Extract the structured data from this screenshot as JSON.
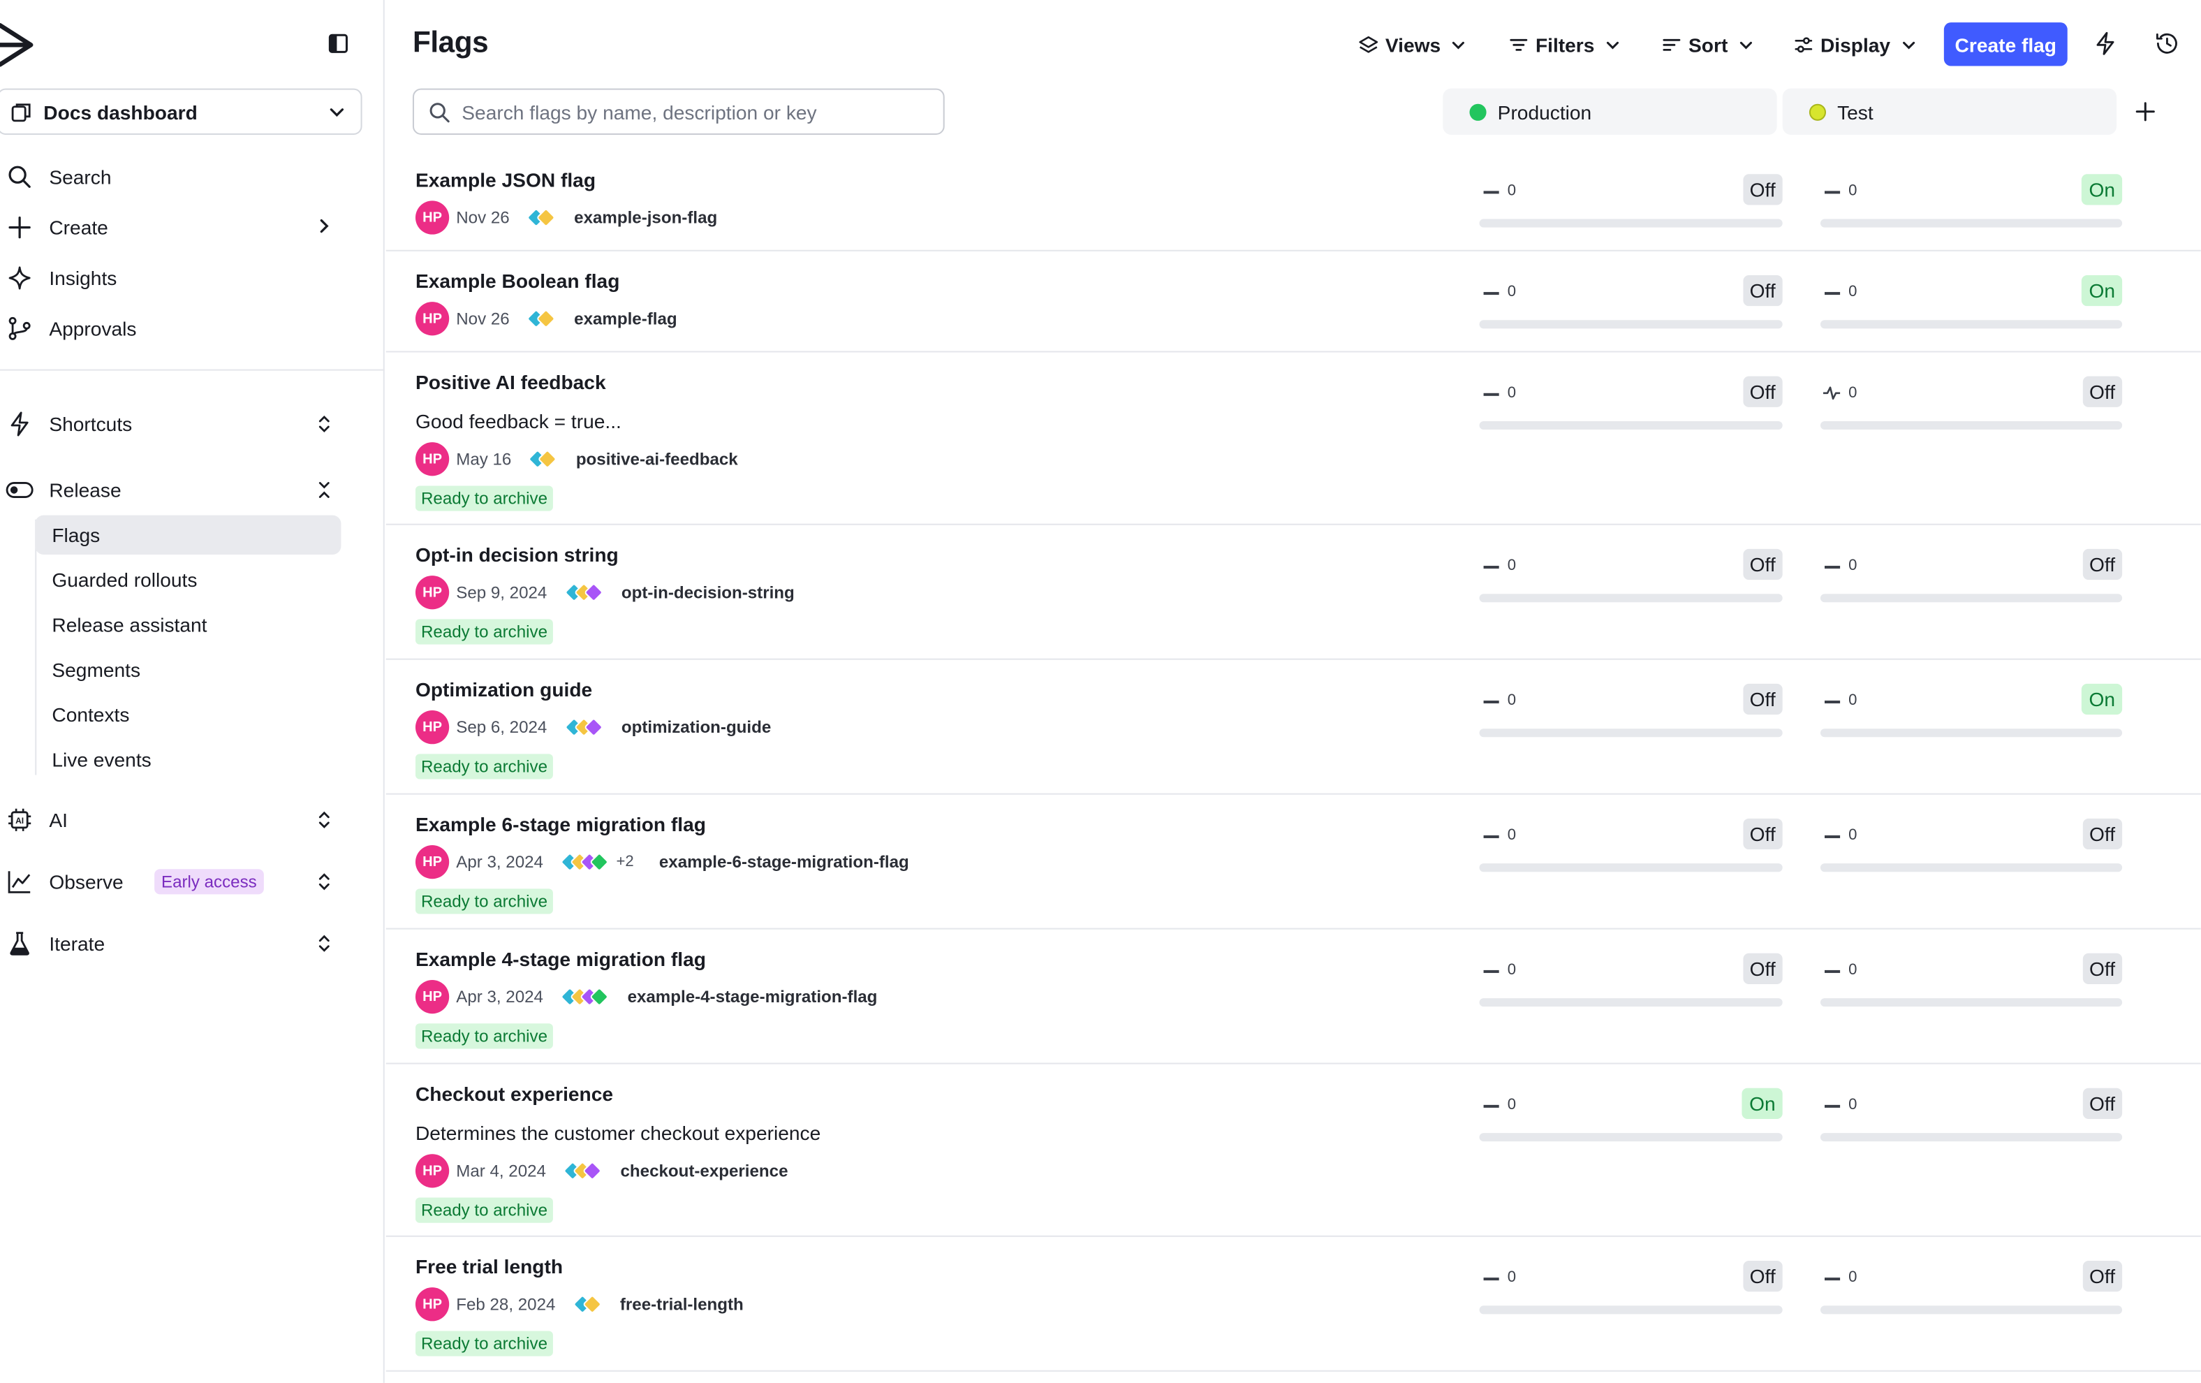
{
  "sidebar": {
    "project": "Docs dashboard",
    "nav": [
      {
        "label": "Search",
        "icon": "search-icon"
      },
      {
        "label": "Create",
        "icon": "plus-icon"
      },
      {
        "label": "Insights",
        "icon": "sparkle-icon"
      },
      {
        "label": "Approvals",
        "icon": "branch-icon"
      }
    ],
    "groups": [
      {
        "label": "Shortcuts",
        "icon": "lightning-icon"
      },
      {
        "label": "Release",
        "icon": "toggle-icon"
      },
      {
        "label": "AI",
        "icon": "chip-icon"
      },
      {
        "label": "Observe",
        "icon": "chart-icon",
        "badge": "Early access"
      },
      {
        "label": "Iterate",
        "icon": "flask-icon"
      }
    ],
    "release_items": [
      "Flags",
      "Guarded rollouts",
      "Release assistant",
      "Segments",
      "Contexts",
      "Live events"
    ]
  },
  "header": {
    "title": "Flags",
    "views": "Views",
    "filters": "Filters",
    "sort": "Sort",
    "display": "Display",
    "create": "Create flag"
  },
  "search": {
    "placeholder": "Search flags by name, description or key"
  },
  "environments": [
    {
      "name": "Production",
      "color": "#22c55e"
    },
    {
      "name": "Test",
      "color": "#d7e52e"
    }
  ],
  "colors": {
    "accent": "#405bff",
    "avatar": "#ec2d86",
    "on": "#0b7a34"
  },
  "flags": [
    {
      "name": "Example JSON flag",
      "desc": "",
      "avatar": "HP",
      "date": "Nov 26",
      "more": "",
      "key": "example-json-flag",
      "ready": "",
      "prod_count": "0",
      "prod_state": "Off",
      "test_count": "0",
      "test_state": "On"
    },
    {
      "name": "Example Boolean flag",
      "desc": "",
      "avatar": "HP",
      "date": "Nov 26",
      "more": "",
      "key": "example-flag",
      "ready": "",
      "prod_count": "0",
      "prod_state": "Off",
      "test_count": "0",
      "test_state": "On"
    },
    {
      "name": "Positive AI feedback",
      "desc": "Good feedback = true...",
      "avatar": "HP",
      "date": "May 16",
      "more": "",
      "key": "positive-ai-feedback",
      "ready": "Ready to archive",
      "prod_count": "0",
      "prod_state": "Off",
      "test_count": "0",
      "test_state": "Off"
    },
    {
      "name": "Opt-in decision string",
      "desc": "",
      "avatar": "HP",
      "date": "Sep 9, 2024",
      "more": "",
      "key": "opt-in-decision-string",
      "ready": "Ready to archive",
      "prod_count": "0",
      "prod_state": "Off",
      "test_count": "0",
      "test_state": "Off"
    },
    {
      "name": "Optimization guide",
      "desc": "",
      "avatar": "HP",
      "date": "Sep 6, 2024",
      "more": "",
      "key": "optimization-guide",
      "ready": "Ready to archive",
      "prod_count": "0",
      "prod_state": "Off",
      "test_count": "0",
      "test_state": "On"
    },
    {
      "name": "Example 6-stage migration flag",
      "desc": "",
      "avatar": "HP",
      "date": "Apr 3, 2024",
      "more": "+2",
      "key": "example-6-stage-migration-flag",
      "ready": "Ready to archive",
      "prod_count": "0",
      "prod_state": "Off",
      "test_count": "0",
      "test_state": "Off"
    },
    {
      "name": "Example 4-stage migration flag",
      "desc": "",
      "avatar": "HP",
      "date": "Apr 3, 2024",
      "more": "",
      "key": "example-4-stage-migration-flag",
      "ready": "Ready to archive",
      "prod_count": "0",
      "prod_state": "Off",
      "test_count": "0",
      "test_state": "Off"
    },
    {
      "name": "Checkout experience",
      "desc": "Determines the customer checkout experience",
      "avatar": "HP",
      "date": "Mar 4, 2024",
      "more": "",
      "key": "checkout-experience",
      "ready": "Ready to archive",
      "prod_count": "0",
      "prod_state": "On",
      "test_count": "0",
      "test_state": "Off"
    },
    {
      "name": "Free trial length",
      "desc": "",
      "avatar": "HP",
      "date": "Feb 28, 2024",
      "more": "",
      "key": "free-trial-length",
      "ready": "Ready to archive",
      "prod_count": "0",
      "prod_state": "Off",
      "test_count": "0",
      "test_state": "Off"
    }
  ]
}
